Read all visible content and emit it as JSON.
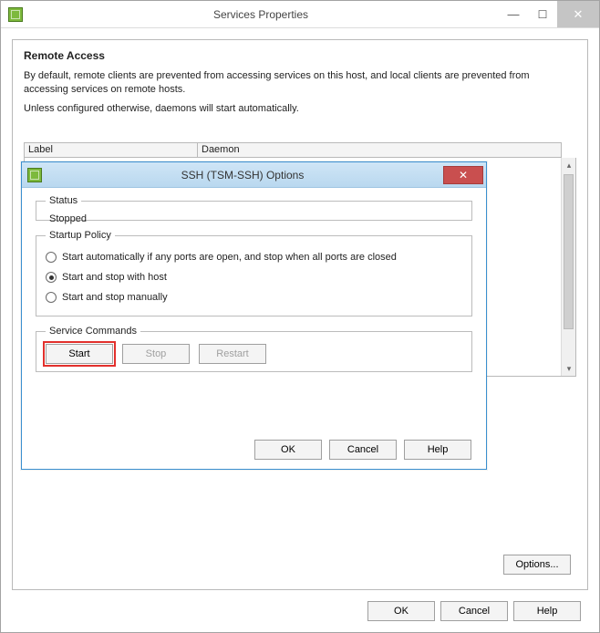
{
  "parent": {
    "title": "Services Properties",
    "heading": "Remote Access",
    "desc1": "By default, remote clients are prevented from accessing services on this host, and local clients are prevented from accessing services on remote hosts.",
    "desc2": "Unless configured otherwise, daemons will start automatically.",
    "table": {
      "col1": "Label",
      "col2": "Daemon"
    },
    "options_btn": "Options...",
    "footer": {
      "ok": "OK",
      "cancel": "Cancel",
      "help": "Help"
    }
  },
  "modal": {
    "title": "SSH (TSM-SSH) Options",
    "status_legend": "Status",
    "status_value": "Stopped",
    "policy_legend": "Startup Policy",
    "policy": {
      "opt1": "Start automatically if any ports are open, and stop when all ports are closed",
      "opt2": "Start and stop with host",
      "opt3": "Start and stop manually",
      "selected": 1
    },
    "commands_legend": "Service Commands",
    "cmd": {
      "start": "Start",
      "stop": "Stop",
      "restart": "Restart"
    },
    "footer": {
      "ok": "OK",
      "cancel": "Cancel",
      "help": "Help"
    }
  }
}
